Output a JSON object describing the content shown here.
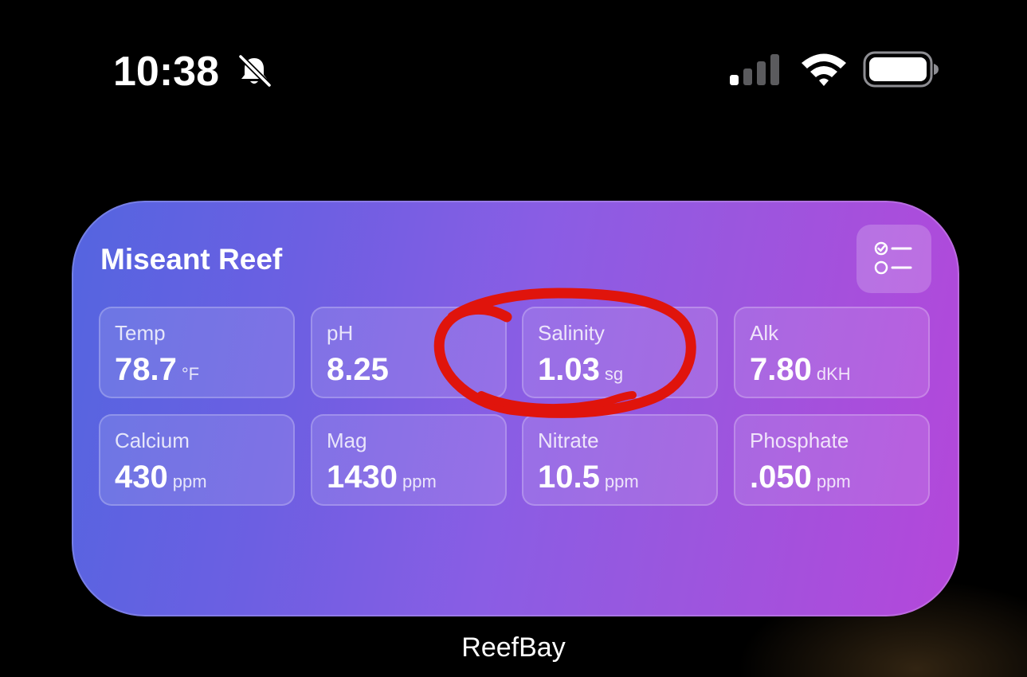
{
  "status_bar": {
    "time": "10:38",
    "bell_icon": "bell-slash-icon",
    "signal_icon": "cellular-signal-icon",
    "wifi_icon": "wifi-icon",
    "battery_icon": "battery-icon"
  },
  "widget": {
    "title": "Miseant Reef",
    "action_icon": "checklist-icon",
    "colors": {
      "gradient_start": "#5465e0",
      "gradient_end": "#b447da"
    },
    "tiles": [
      {
        "label": "Temp",
        "value": "78.7",
        "unit": "°F"
      },
      {
        "label": "pH",
        "value": "8.25",
        "unit": ""
      },
      {
        "label": "Salinity",
        "value": "1.03",
        "unit": "sg"
      },
      {
        "label": "Alk",
        "value": "7.80",
        "unit": "dKH"
      },
      {
        "label": "Calcium",
        "value": "430",
        "unit": "ppm"
      },
      {
        "label": "Mag",
        "value": "1430",
        "unit": "ppm"
      },
      {
        "label": "Nitrate",
        "value": "10.5",
        "unit": "ppm"
      },
      {
        "label": "Phosphate",
        "value": ".050",
        "unit": "ppm"
      }
    ]
  },
  "annotation": {
    "color": "#e0140c",
    "target": "Salinity"
  },
  "app_label": "ReefBay"
}
